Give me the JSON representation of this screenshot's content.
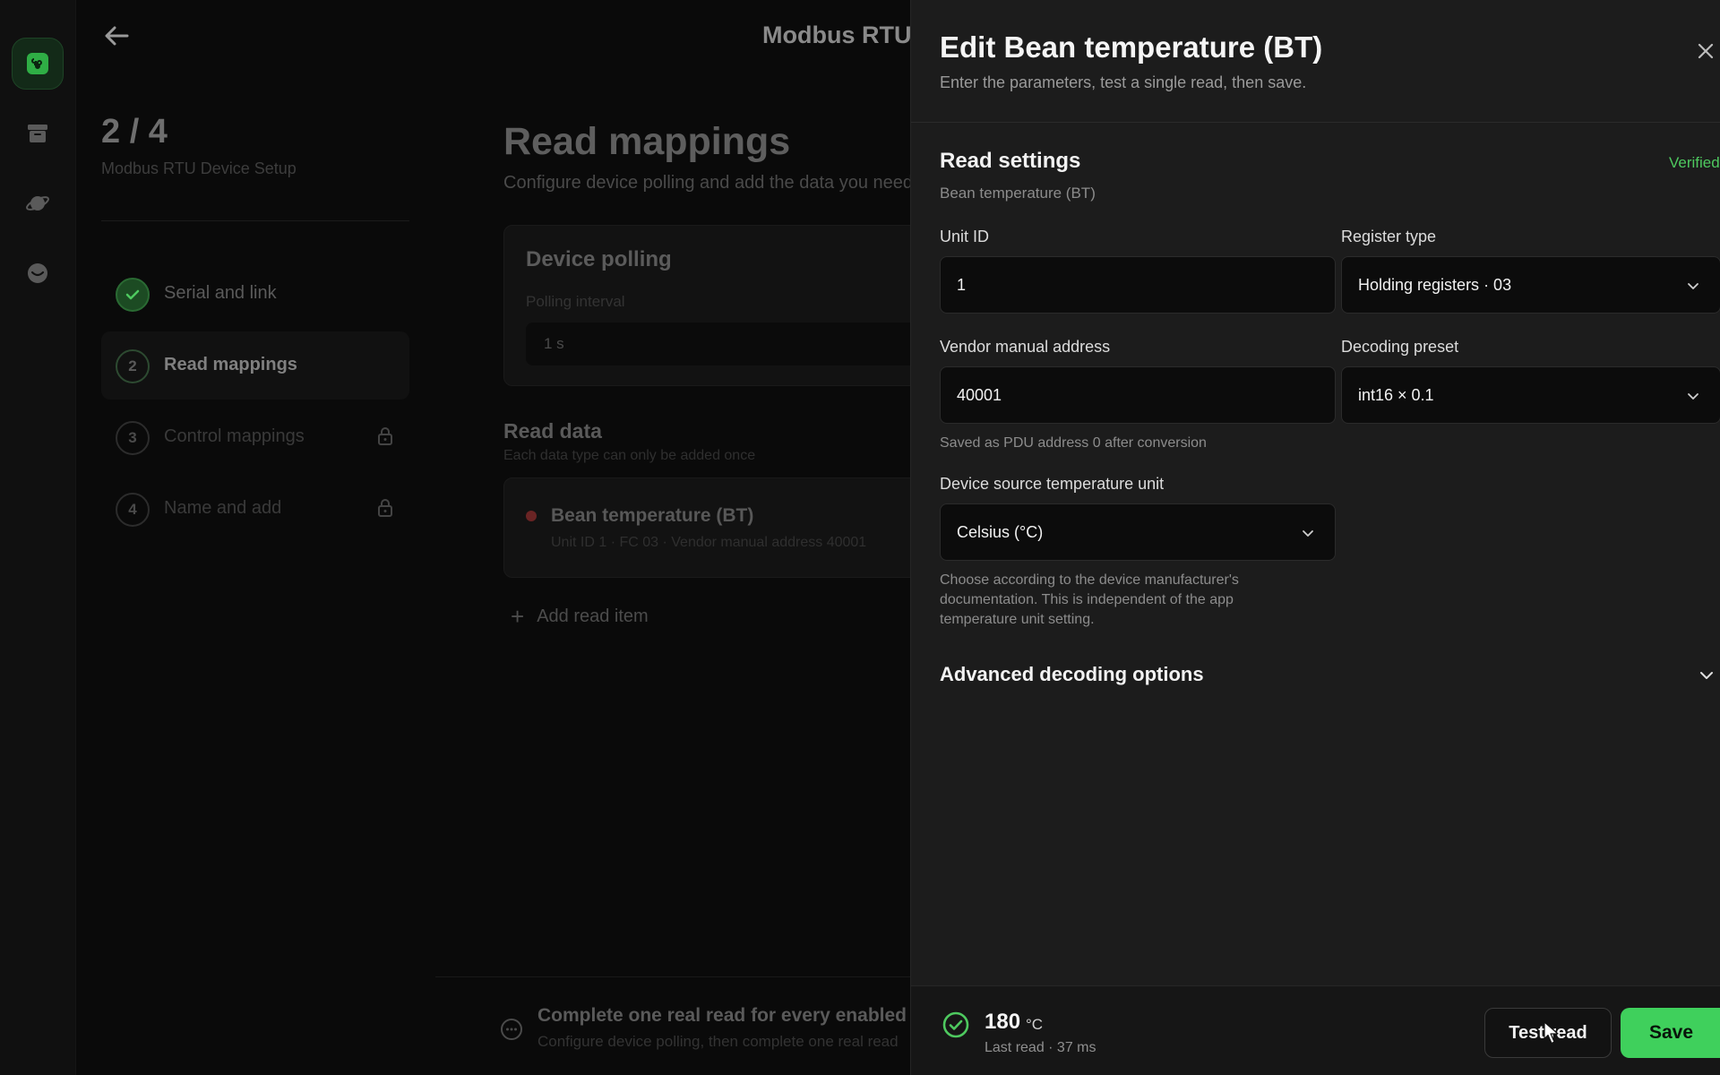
{
  "background": {
    "page_title": "Modbus RTU",
    "step_count": "2 / 4",
    "step_subtitle": "Modbus RTU Device Setup",
    "steps": [
      {
        "number": "1",
        "label": "Serial and link"
      },
      {
        "number": "2",
        "label": "Read mappings"
      },
      {
        "number": "3",
        "label": "Control mappings"
      },
      {
        "number": "4",
        "label": "Name and add"
      }
    ],
    "section_title": "Read mappings",
    "section_subtitle": "Configure device polling and add the data you need",
    "polling": {
      "title": "Device polling",
      "interval_label": "Polling interval",
      "interval_value": "1 s"
    },
    "read_data": {
      "title": "Read data",
      "subtitle": "Each data type can only be added once",
      "item_name": "Bean temperature (BT)",
      "item_meta": "Unit ID 1  ·  FC 03  ·  Vendor manual address 40001"
    },
    "add_read_item": "Add read item",
    "footer_title": "Complete one real read for every enabled mapping",
    "footer_subtitle": "Configure device polling, then complete one real read"
  },
  "drawer": {
    "title": "Edit Bean temperature (BT)",
    "subtitle": "Enter the parameters, test a single read, then save.",
    "read_settings": {
      "title": "Read settings",
      "subtitle": "Bean temperature (BT)",
      "status": "Verified"
    },
    "fields": {
      "unit_id": {
        "label": "Unit ID",
        "value": "1"
      },
      "register_type": {
        "label": "Register type",
        "value": "Holding registers · 03"
      },
      "vendor_address": {
        "label": "Vendor manual address",
        "value": "40001",
        "help": "Saved as PDU address 0 after conversion"
      },
      "decoding_preset": {
        "label": "Decoding preset",
        "value": "int16 × 0.1"
      },
      "temp_unit": {
        "label": "Device source temperature unit",
        "value": "Celsius (°C)",
        "help": "Choose according to the device manufacturer's documentation. This is independent of the app temperature unit setting."
      }
    },
    "advanced": "Advanced decoding options",
    "footer": {
      "value": "180",
      "unit": "°C",
      "last_read": "Last read · 37 ms",
      "test_read": "Test read",
      "save": "Save"
    }
  },
  "colors": {
    "accent_green": "#3fd05c",
    "verified_green": "#4ec95f",
    "drawer_bg": "#1c1c1c"
  },
  "icons": [
    "command-icon",
    "archive-icon",
    "planet-icon",
    "smile-icon",
    "back-arrow-icon",
    "check-icon",
    "lock-icon",
    "close-icon",
    "chevron-down-icon",
    "plus-icon",
    "check-circle-icon",
    "cursor-icon"
  ]
}
